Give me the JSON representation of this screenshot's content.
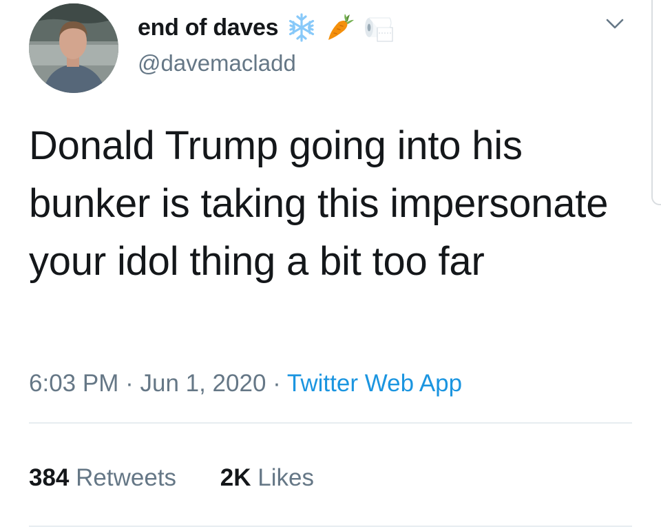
{
  "tweet": {
    "author": {
      "display_name": "end of daves",
      "handle": "@davemacladd",
      "name_emojis": [
        "snowflake-icon",
        "carrot-icon",
        "toilet-paper-icon"
      ]
    },
    "text": "Donald Trump going into his bunker is taking this impersonate your idol thing a bit too far",
    "time": "6:03 PM",
    "separator": "·",
    "date": "Jun 1, 2020",
    "source": "Twitter Web App",
    "stats": {
      "retweets_count": "384",
      "retweets_label": "Retweets",
      "likes_count": "2K",
      "likes_label": "Likes"
    }
  },
  "colors": {
    "text_primary": "#14171a",
    "text_secondary": "#657786",
    "link": "#1b95e0",
    "divider": "#e6ecf0"
  },
  "icons": {
    "more_menu": "chevron-down-icon"
  }
}
